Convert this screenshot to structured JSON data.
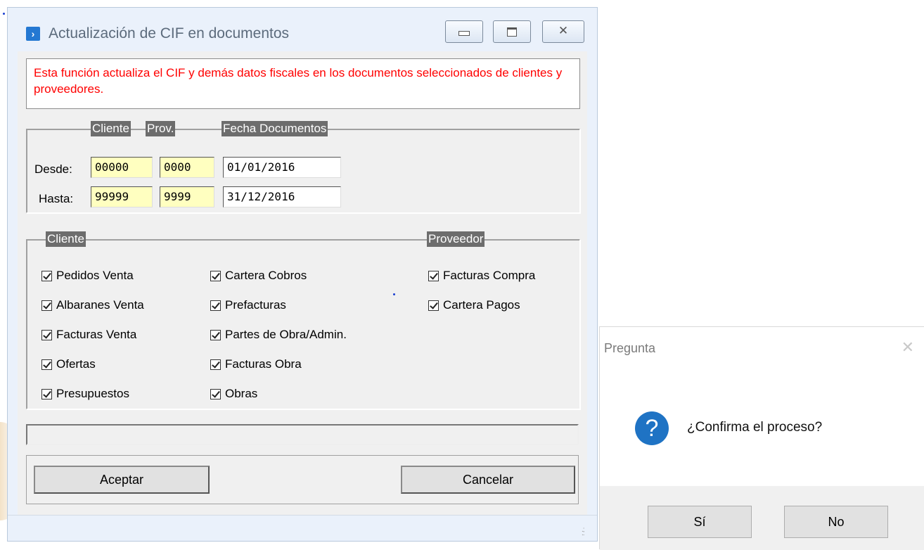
{
  "window": {
    "title": "Actualización de CIF en documentos",
    "info_text": "Esta función actualiza el CIF y demás datos fiscales en los documentos seleccionados de clientes y proveedores.",
    "range": {
      "col_cliente": "Cliente",
      "col_prov": "Prov.",
      "col_fecha": "Fecha Documentos",
      "desde_label": "Desde:",
      "hasta_label": "Hasta:",
      "desde": {
        "cliente": "00000",
        "prov": "0000",
        "fecha": "01/01/2016"
      },
      "hasta": {
        "cliente": "99999",
        "prov": "9999",
        "fecha": "31/12/2016"
      }
    },
    "cliente_group": "Cliente",
    "proveedor_group": "Proveedor",
    "cliente_col1": [
      "Pedidos Venta",
      "Albaranes Venta",
      "Facturas Venta",
      "Ofertas",
      "Presupuestos"
    ],
    "cliente_col2": [
      "Cartera Cobros",
      "Prefacturas",
      "Partes de Obra/Admin.",
      "Facturas Obra",
      "Obras"
    ],
    "proveedor_items": [
      "Facturas Compra",
      "Cartera Pagos"
    ],
    "accept_label": "Aceptar",
    "cancel_label": "Cancelar"
  },
  "dialog": {
    "title": "Pregunta",
    "message": "¿Confirma el proceso?",
    "yes_label": "Sí",
    "no_label": "No"
  },
  "colors": {
    "info_text": "#ff0000",
    "field_yellow": "#ffffc0",
    "question_icon": "#1f73c4"
  }
}
